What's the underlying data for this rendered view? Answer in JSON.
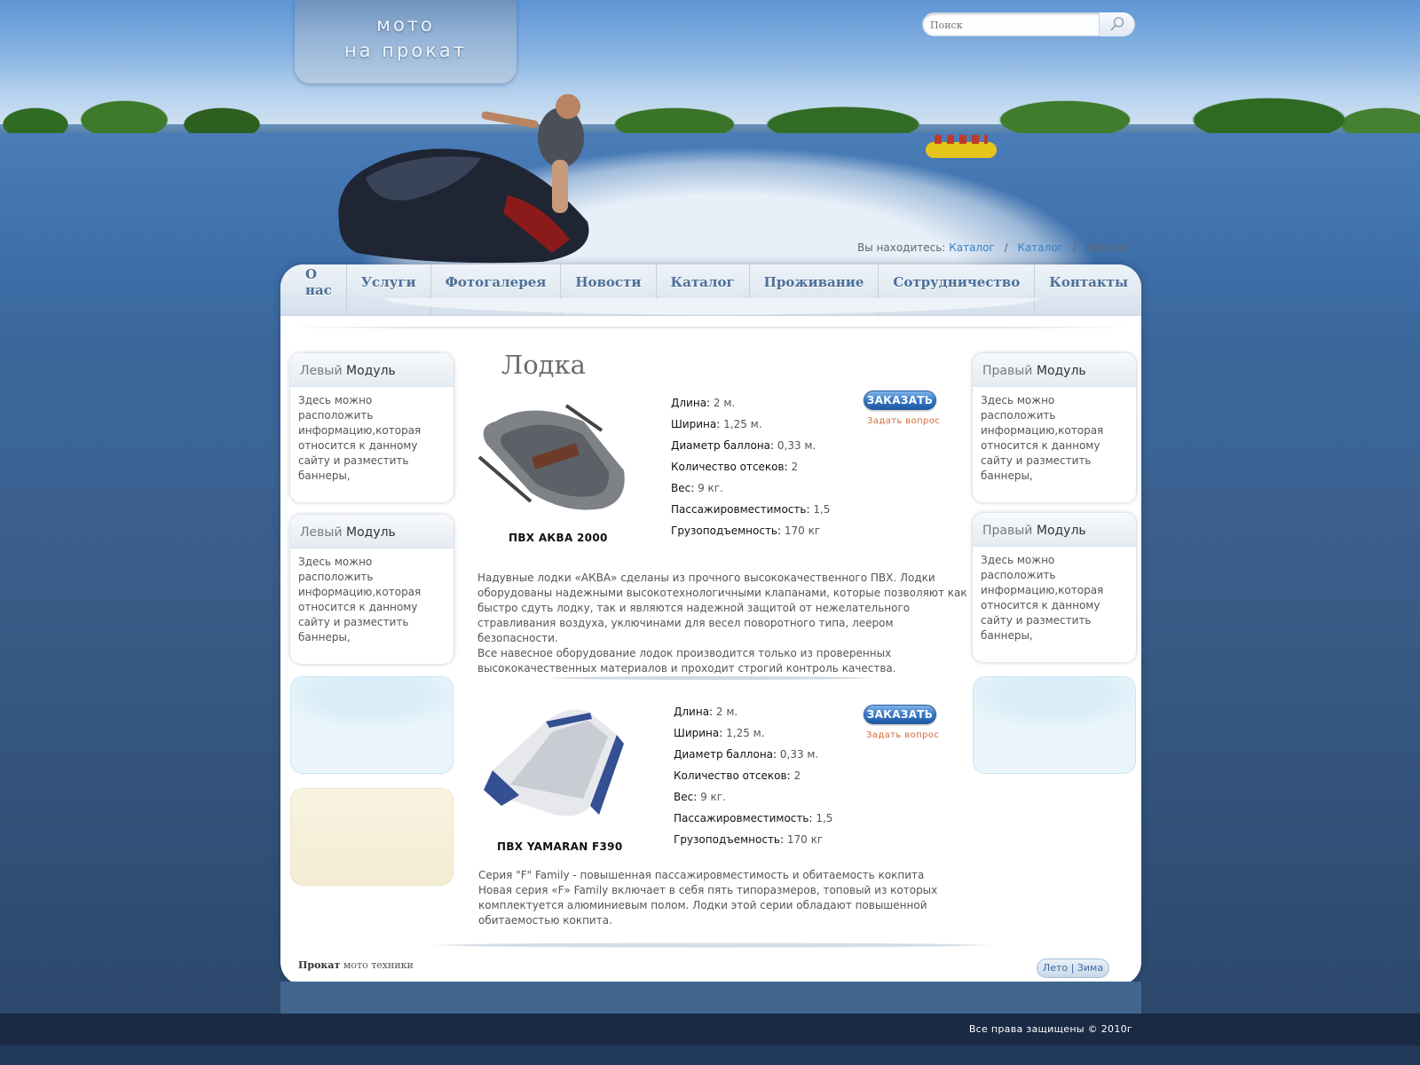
{
  "logo": {
    "line1": "мото",
    "line2": "на прокат"
  },
  "search": {
    "placeholder": "Поиск"
  },
  "breadcrumb": {
    "prefix": "Вы находитесь:",
    "items": [
      "Каталог",
      "Каталог",
      "Каталог"
    ],
    "separator": "/"
  },
  "nav": {
    "items": [
      "О нас",
      "Услуги",
      "Фотогалерея",
      "Новости",
      "Каталог",
      "Проживание",
      "Сотрудничество",
      "Контакты"
    ]
  },
  "left_modules": [
    {
      "title_light": "Левый",
      "title_dark": "Модуль",
      "text": "Здесь можно расположить информацию,которая относится к данному сайту и разместить баннеры,"
    },
    {
      "title_light": "Левый",
      "title_dark": "Модуль",
      "text": "Здесь можно расположить информацию,которая относится к данному сайту и разместить баннеры,"
    }
  ],
  "right_modules": [
    {
      "title_light": "Правый",
      "title_dark": "Модуль",
      "text": "Здесь можно расположить информацию,которая относится к данному сайту и разместить баннеры,"
    },
    {
      "title_light": "Правый",
      "title_dark": "Модуль",
      "text": "Здесь можно расположить информацию,которая относится к данному сайту и разместить баннеры,"
    }
  ],
  "page_title": "Лодка",
  "products": [
    {
      "name": "ПВХ  АКВА 2000",
      "order_label": "ЗАКАЗАТЬ",
      "ask_label": "Задать вопрос",
      "specs": [
        {
          "k": "Длина:",
          "v": "2 м."
        },
        {
          "k": "Ширина:",
          "v": "1,25 м."
        },
        {
          "k": "Диаметр баллона:",
          "v": "0,33 м."
        },
        {
          "k": "Количество отсеков:",
          "v": "2"
        },
        {
          "k": "Вес:",
          "v": "9 кг."
        },
        {
          "k": "Пассажировместимость:",
          "v": "1,5"
        },
        {
          "k": "Грузоподъемность:",
          "v": "170 кг"
        }
      ],
      "description": [
        "Надувные лодки «АКВА» сделаны из прочного высококачественного ПВХ. Лодки",
        "оборудованы надежными высокотехнологичными клапанами, которые позволяют как",
        "быстро сдуть лодку, так и являются надежной защитой от нежелательного",
        "стравливания воздуха, уключинами для весел поворотного типа, леером безопасности.",
        "Все навесное оборудование лодок производится только из проверенных",
        "высококачественных материалов и проходит строгий контроль качества."
      ]
    },
    {
      "name": "ПВХ YAMARAN F390",
      "order_label": "ЗАКАЗАТЬ",
      "ask_label": "Задать вопрос",
      "specs": [
        {
          "k": "Длина:",
          "v": "2 м."
        },
        {
          "k": "Ширина:",
          "v": "1,25 м."
        },
        {
          "k": "Диаметр баллона:",
          "v": "0,33 м."
        },
        {
          "k": "Количество отсеков:",
          "v": "2"
        },
        {
          "k": "Вес:",
          "v": "9 кг."
        },
        {
          "k": "Пассажировместимость:",
          "v": "1,5"
        },
        {
          "k": "Грузоподъемность:",
          "v": "170 кг"
        }
      ],
      "description": [
        "Серия \"F\" Family - повышенная пассажировместимость и обитаемость кокпита",
        "Новая серия «F» Family включает в себя пять типоразмеров, топовый из которых",
        "комплектуется алюминиевым полом. Лодки этой серии обладают повышенной",
        "обитаемостью кокпита."
      ]
    }
  ],
  "footer": {
    "brand_bold": "Прокат",
    "brand_rest": "мото техники",
    "season_summer": "Лето",
    "season_sep": "|",
    "season_winter": "Зима",
    "copyright": "Все права защищены",
    "copyright_year": "© 2010г"
  },
  "colors": {
    "link": "#3b82c4",
    "nav_text": "#4c6f98",
    "order_button": "#3778c4",
    "ask_link": "#d26a3a",
    "bottom_bar": "#1a2a45"
  },
  "icons": {
    "search_button": "magnifier-icon"
  }
}
